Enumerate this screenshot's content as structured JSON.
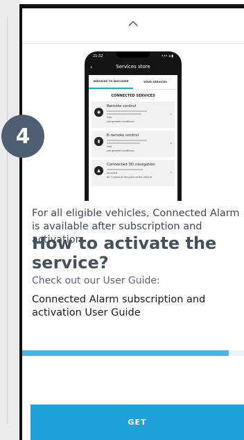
{
  "step_badge": "4",
  "top_handle_icon": "chevron-up-icon",
  "mock_screen": {
    "status_time": "21:32",
    "status_right": "••• ◂ ▮",
    "nav_title": "Services store",
    "tabs": [
      {
        "label": "SERVICES TO DISCOVER",
        "active": true
      },
      {
        "label": "YOUR SERVICES",
        "active": false
      }
    ],
    "section_title": "CONNECTED SERVICES",
    "cards": [
      {
        "title": "Remote control",
        "icon": "car-icon",
        "price": "Free",
        "terms": "see general conditions"
      },
      {
        "title": "E-remote control",
        "icon": "plug-icon",
        "price": "Free",
        "terms": "see general conditions"
      },
      {
        "title": "Connected 3D navigation",
        "icon": "navigation-icon",
        "price": "Included",
        "terms": "for 3 years at the price of the vehicle"
      }
    ]
  },
  "body_text": "For all eligible vehicles, Connected Alarm is available after subscription and activation.",
  "heading": "How to activate the service?",
  "subheading": "Check out our User Guide:",
  "guide_link": "Connected Alarm subscription and activation User Guide",
  "progress": 0.93,
  "get_button_label": "GET",
  "colors": {
    "accent": "#1ea0d8",
    "badge": "#4e5e73",
    "progress": "#4ab4e6"
  }
}
